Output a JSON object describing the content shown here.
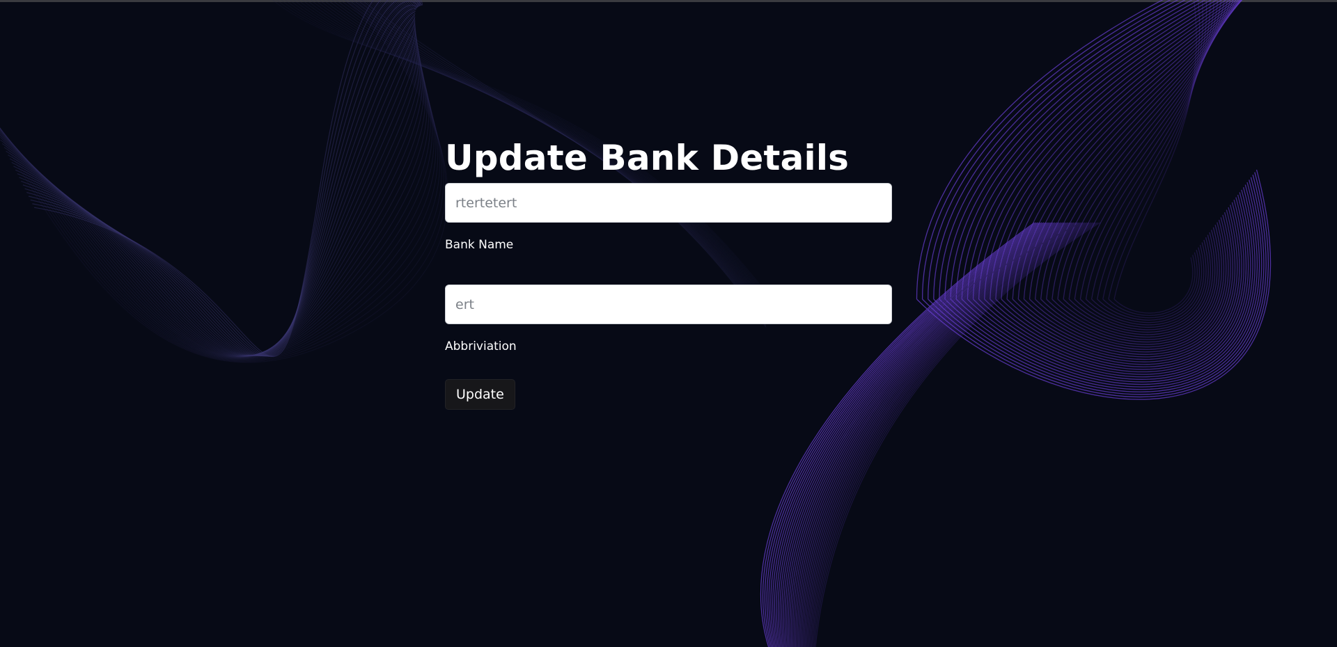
{
  "form": {
    "title": "Update Bank Details",
    "bank_name": {
      "placeholder": "rtertetert",
      "label": "Bank Name"
    },
    "abbreviation": {
      "placeholder": "ert",
      "label": "Abbriviation"
    },
    "submit_label": "Update"
  },
  "theme": {
    "background": "#070a16",
    "wave_left": "#3b3772",
    "wave_right": "#6a3fd6"
  }
}
